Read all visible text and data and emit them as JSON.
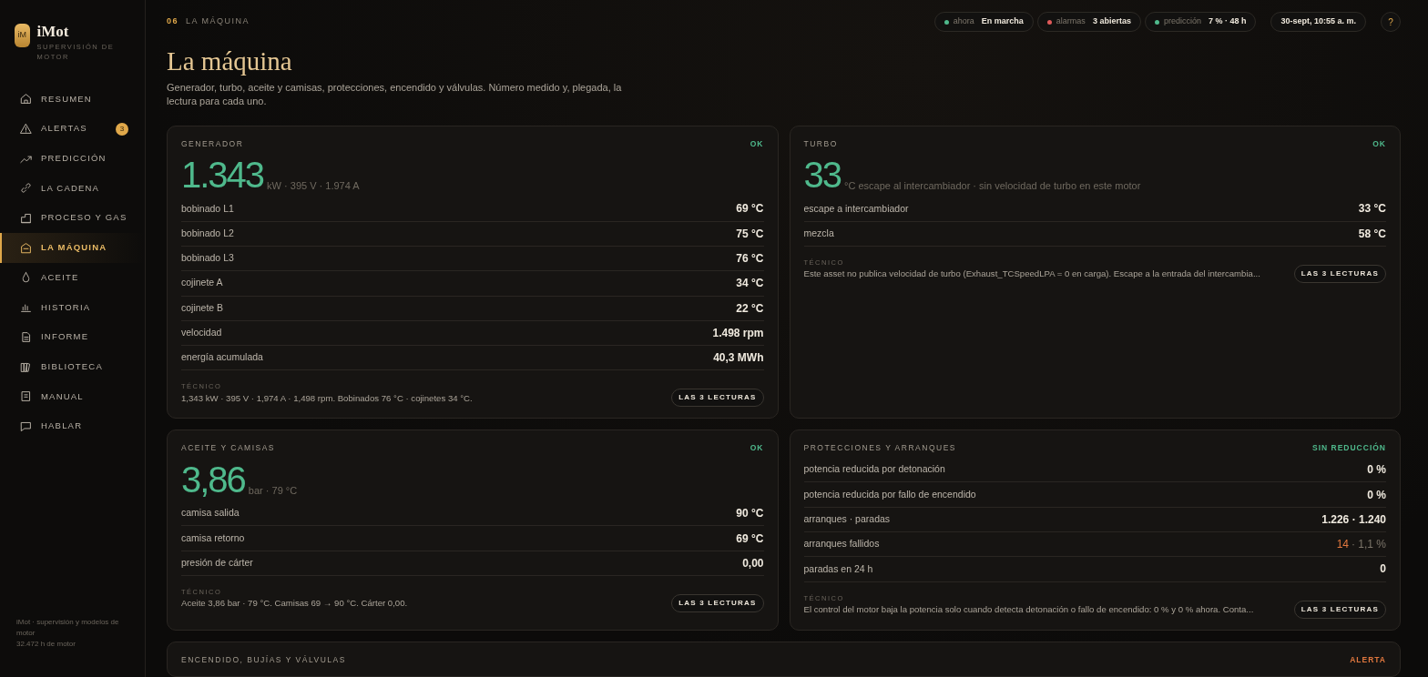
{
  "brand": {
    "logo": "iM",
    "name": "iMot",
    "tagline": "SUPERVISIÓN DE MOTOR"
  },
  "nav": [
    {
      "label": "RESUMEN",
      "selected": false
    },
    {
      "label": "ALERTAS",
      "selected": false,
      "badge": "3"
    },
    {
      "label": "PREDICCIÓN",
      "selected": false
    },
    {
      "label": "LA CADENA",
      "selected": false
    },
    {
      "label": "PROCESO Y GAS",
      "selected": false
    },
    {
      "label": "LA MÁQUINA",
      "selected": true
    },
    {
      "label": "ACEITE",
      "selected": false
    },
    {
      "label": "HISTORIA",
      "selected": false
    },
    {
      "label": "INFORME",
      "selected": false
    },
    {
      "label": "BIBLIOTECA",
      "selected": false
    },
    {
      "label": "MANUAL",
      "selected": false
    },
    {
      "label": "HABLAR",
      "selected": false
    }
  ],
  "footer": [
    "iMot · supervisión y modelos de motor",
    "32.472 h de motor"
  ],
  "breadcrumb": {
    "number": "06",
    "label": "LA MÁQUINA"
  },
  "status_pills": [
    {
      "label": "ahora",
      "value": "En marcha",
      "color": "#4fb98c"
    },
    {
      "label": "alarmas",
      "value": "3 abiertas",
      "color": "#e05a5a"
    },
    {
      "label": "predicción",
      "value": "7 % · 48 h",
      "color": "#4fb98c"
    }
  ],
  "datetime": "30-sept, 10:55 a. m.",
  "help": "?",
  "title": "La máquina",
  "subtitle": "Generador, turbo, aceite y camisas, protecciones, encendido y válvulas. Número medido y, plegada, la lectura para cada uno.",
  "cards": [
    {
      "title": "GENERADOR",
      "status": "OK",
      "alert": false,
      "big_value": "1.343",
      "big_unit": "kW · 395 V · 1.974 A",
      "rows": [
        {
          "label": "bobinado L1",
          "value": "69 °C"
        },
        {
          "label": "bobinado L2",
          "value": "75 °C"
        },
        {
          "label": "bobinado L3",
          "value": "76 °C"
        },
        {
          "label": "cojinete A",
          "value": "34 °C"
        },
        {
          "label": "cojinete B",
          "value": "22 °C"
        },
        {
          "label": "velocidad",
          "value": "1.498 rpm"
        },
        {
          "label": "energía acumulada",
          "value": "40,3 MWh"
        }
      ],
      "tech_label": "TÉCNICO",
      "tech_text": "1,343 kW · 395 V · 1,974 A · 1,498 rpm. Bobinados 76 °C · cojinetes 34 °C.",
      "button": "LAS 3 LECTURAS"
    },
    {
      "title": "TURBO",
      "status": "OK",
      "alert": false,
      "big_value": "33",
      "big_unit": "°C escape al intercambiador · sin velocidad de turbo en este motor",
      "rows": [
        {
          "label": "escape a intercambiador",
          "value": "33 °C"
        },
        {
          "label": "mezcla",
          "value": "58 °C"
        }
      ],
      "tech_label": "TÉCNICO",
      "tech_text": "Este asset no publica velocidad de turbo (Exhaust_TCSpeedLPA = 0 en carga). Escape a la entrada del intercambia...",
      "button": "LAS 3 LECTURAS"
    },
    {
      "title": "ACEITE Y CAMISAS",
      "status": "OK",
      "alert": false,
      "big_value": "3,86",
      "big_unit": "bar · 79 °C",
      "rows": [
        {
          "label": "camisa salida",
          "value": "90 °C"
        },
        {
          "label": "camisa retorno",
          "value": "69 °C"
        },
        {
          "label": "presión de cárter",
          "value": "0,00"
        }
      ],
      "tech_label": "TÉCNICO",
      "tech_text": "Aceite 3,86 bar · 79 °C. Camisas 69 → 90 °C. Cárter 0,00.",
      "button": "LAS 3 LECTURAS"
    },
    {
      "title": "PROTECCIONES Y ARRANQUES",
      "status": "SIN REDUCCIÓN",
      "alert": false,
      "rows": [
        {
          "label": "potencia reducida por detonación",
          "value": "0 %"
        },
        {
          "label": "potencia reducida por fallo de encendido",
          "value": "0 %"
        },
        {
          "label": "arranques · paradas",
          "value": "1.226 · 1.240"
        },
        {
          "label": "arranques fallidos",
          "alert_value": "14",
          "value": "· 1,1 %"
        },
        {
          "label": "paradas en 24 h",
          "value": "0"
        }
      ],
      "tech_label": "TÉCNICO",
      "tech_text": "El control del motor baja la potencia solo cuando detecta detonación o fallo de encendido: 0 % y 0 % ahora. Conta...",
      "button": "LAS 3 LECTURAS"
    },
    {
      "title": "ENCENDIDO, BUJÍAS Y VÁLVULAS",
      "status": "ALERTA",
      "alert": true,
      "wide": true
    }
  ]
}
